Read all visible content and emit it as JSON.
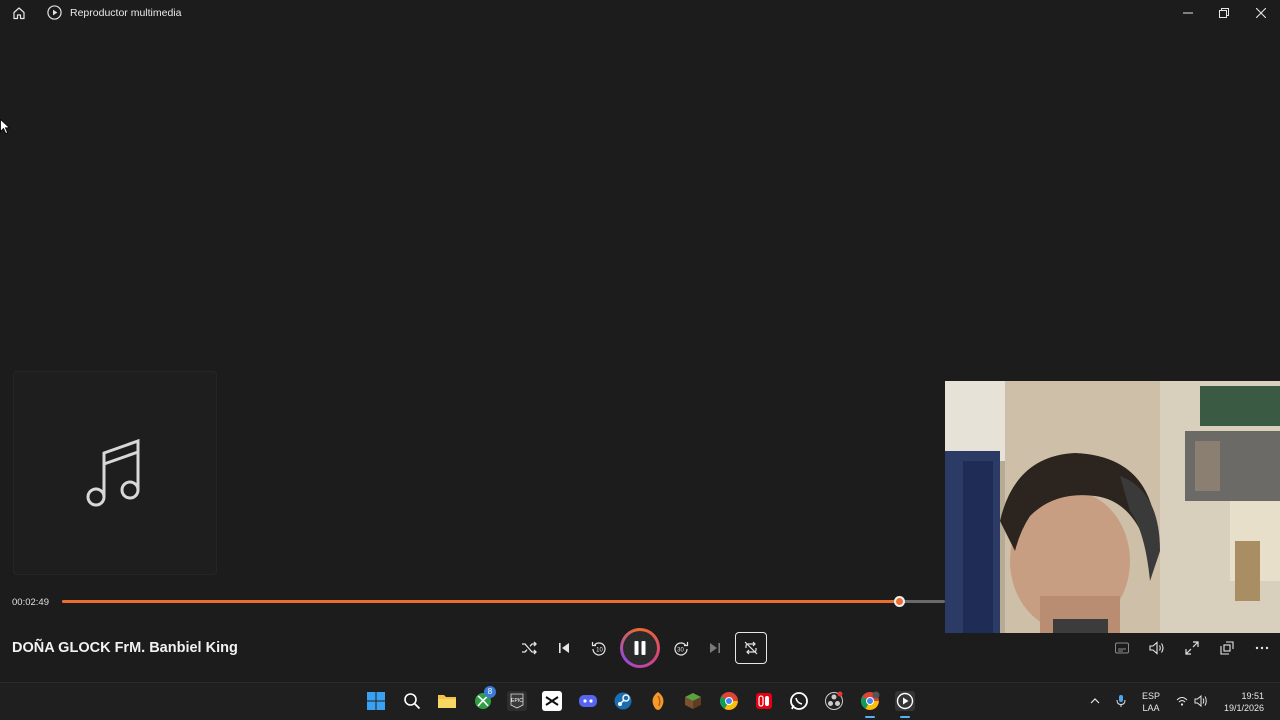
{
  "window": {
    "title": "Reproductor multimedia"
  },
  "player": {
    "elapsed_time": "00:02:49",
    "progress_fraction": 0.948,
    "song_title": "DOÑA GLOCK FrM. Banbiel King"
  },
  "colors": {
    "accent": "#ea6f2e",
    "background": "#1c1c1c",
    "track": "#6a6a6a"
  },
  "controls": [
    "shuffle-icon",
    "previous-icon",
    "rewind-10-icon",
    "pause-icon",
    "forward-30-icon",
    "next-icon",
    "repeat-off-icon"
  ],
  "right_controls": [
    "captions-icon",
    "volume-icon",
    "fullscreen-icon",
    "mini-player-icon",
    "more-icon"
  ],
  "taskbar": {
    "apps": [
      "windows-start",
      "search",
      "file-explorer",
      "xbox",
      "epic-games",
      "capcut",
      "discord",
      "steam",
      "fl-studio",
      "minecraft",
      "chrome",
      "nintendo-switch",
      "whatsapp",
      "obs",
      "chrome-profile",
      "media-player"
    ],
    "xbox_badge": "8",
    "tray": {
      "language_line1": "ESP",
      "language_line2": "LAA",
      "time": "19:51",
      "date": "19/1/2026"
    }
  }
}
